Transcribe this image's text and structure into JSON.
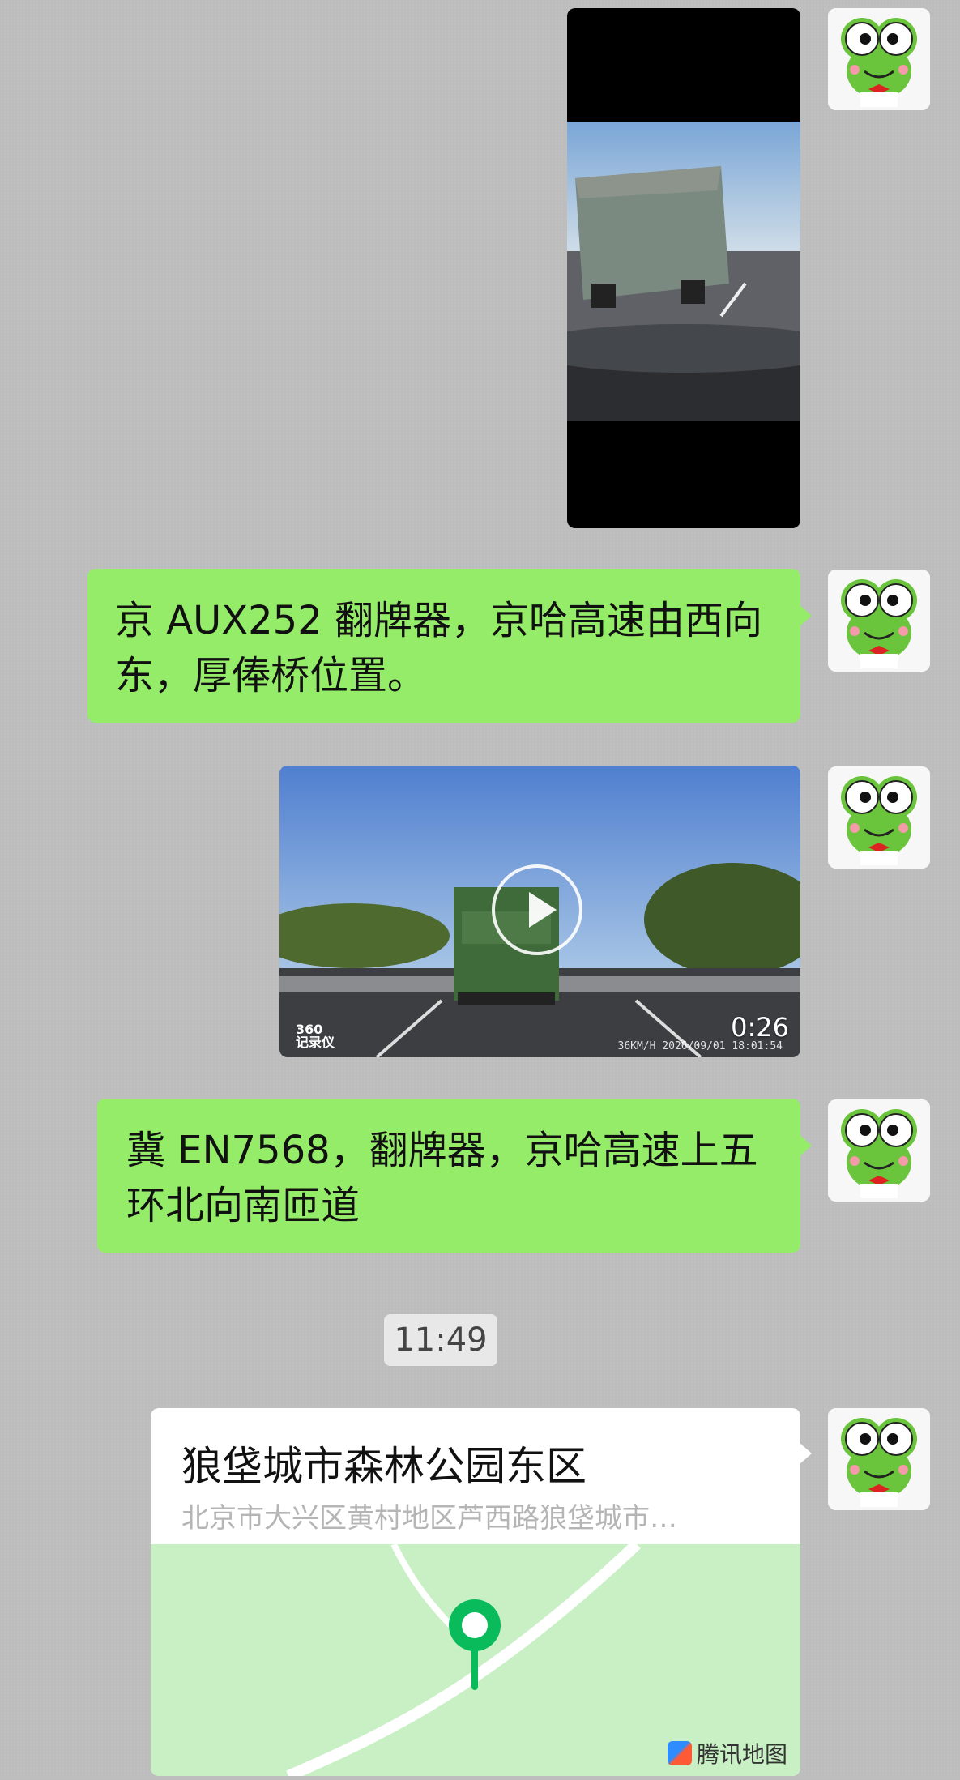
{
  "messages": {
    "msg1_text": "京 AUX252 翻牌器，京哈高速由西向东，厚俸桥位置。",
    "msg2_text": "冀 EN7568，翻牌器，京哈高速上五环北向南匝道",
    "video2_duration": "0:26",
    "video2_stamp": "36KM/H 2026/09/01 18:01:54",
    "video2_brand": "360\n记录仪",
    "timestamp": "11:49"
  },
  "location": {
    "title": "狼垡城市森林公园东区",
    "address": "北京市大兴区黄村地区芦西路狼垡城市…",
    "map_brand": "腾讯地图"
  },
  "colors": {
    "chat_background": "#bdbdbd",
    "sent_bubble": "#95ec69",
    "map_background": "#c8f0c4",
    "pin": "#09bb5b"
  },
  "icons": {
    "avatar": "frog-avatar-icon",
    "play": "play-icon",
    "pin": "location-pin-icon"
  }
}
